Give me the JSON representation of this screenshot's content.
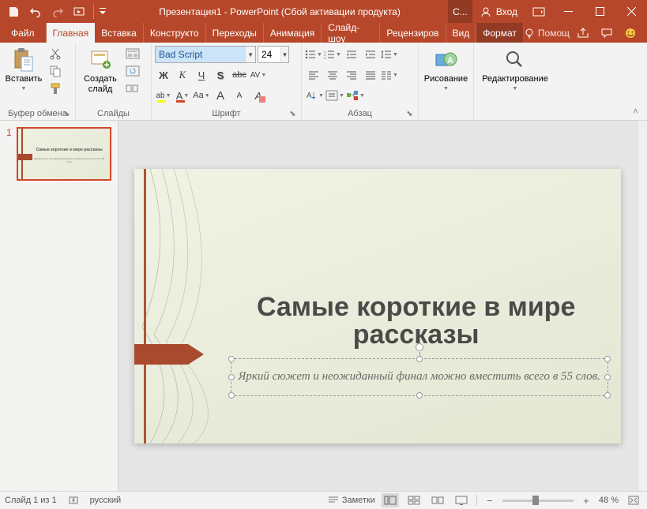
{
  "title": "Презентация1 - PowerPoint (Сбой активации продукта)",
  "login_compact": "С...",
  "login": "Вход",
  "tabs": {
    "file": "Файл",
    "home": "Главная",
    "insert": "Вставка",
    "design": "Конструкто",
    "transitions": "Переходы",
    "animations": "Анимация",
    "slideshow": "Слайд-шоу",
    "review": "Рецензиров",
    "view": "Вид",
    "format": "Формат",
    "help": "Помощ"
  },
  "ribbon": {
    "clipboard": {
      "label": "Буфер обмена",
      "paste": "Вставить"
    },
    "slides": {
      "label": "Слайды",
      "new_slide": "Создать\nслайд"
    },
    "font": {
      "label": "Шрифт",
      "name": "Bad Script",
      "size": "24",
      "bold": "Ж",
      "italic": "К",
      "underline": "Ч",
      "shadow": "S",
      "strike": "abc",
      "spacing": "AV",
      "highlight": "ab",
      "color": "А",
      "caps": "Aa",
      "grow": "A",
      "shrink": "A",
      "clear": "A"
    },
    "paragraph": {
      "label": "Абзац"
    },
    "drawing": {
      "label": "Рисование"
    },
    "editing": {
      "label": "Редактирование"
    }
  },
  "thumb": {
    "num": "1"
  },
  "slide": {
    "title": "Самые короткие в мире рассказы",
    "subtitle": "Яркий сюжет и неожиданный финал можно вместить всего в 55 слов."
  },
  "status": {
    "slide_info": "Слайд 1 из 1",
    "language": "русский",
    "notes": "Заметки",
    "zoom": "48 %"
  }
}
